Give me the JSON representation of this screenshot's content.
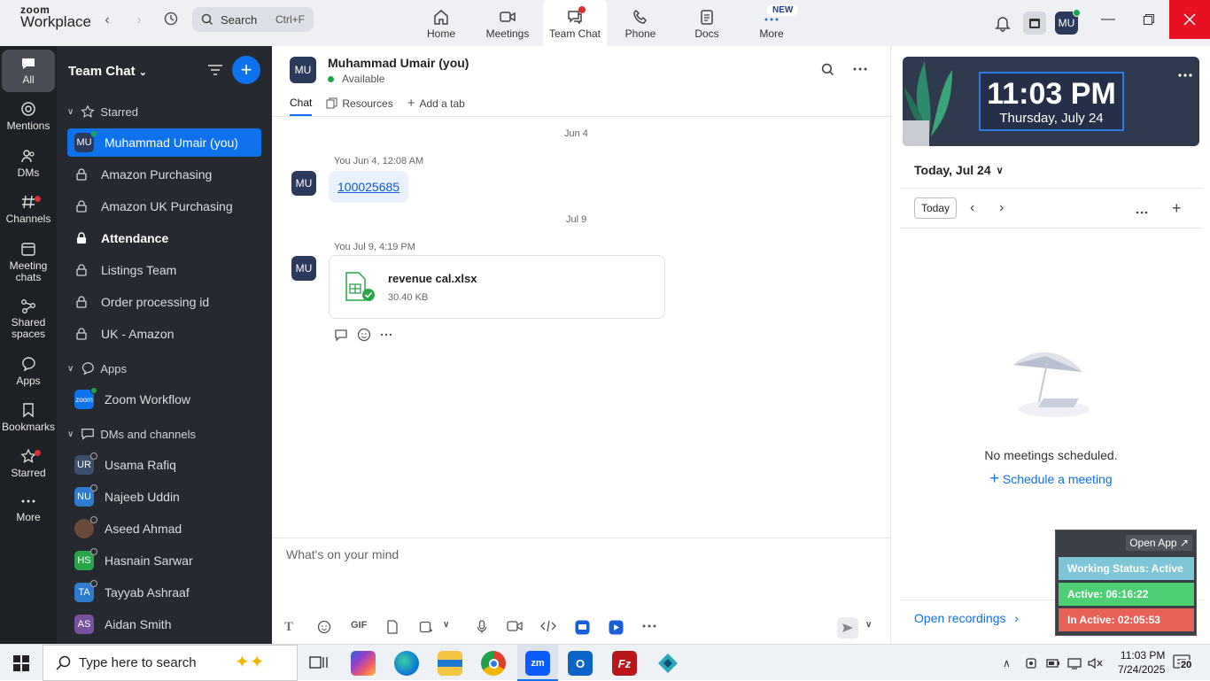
{
  "app": {
    "brand_top": "zoom",
    "brand_bottom": "Workplace"
  },
  "search": {
    "label": "Search",
    "shortcut": "Ctrl+F"
  },
  "nav": [
    {
      "label": "Home",
      "icon": "home-icon"
    },
    {
      "label": "Meetings",
      "icon": "video-icon"
    },
    {
      "label": "Team Chat",
      "icon": "chat-icon",
      "active": true
    },
    {
      "label": "Phone",
      "icon": "phone-icon"
    },
    {
      "label": "Docs",
      "icon": "docs-icon"
    },
    {
      "label": "More",
      "icon": "more-icon",
      "badge": "NEW"
    }
  ],
  "user_avatar": "MU",
  "rail": [
    {
      "label": "All"
    },
    {
      "label": "Mentions"
    },
    {
      "label": "DMs"
    },
    {
      "label": "Channels"
    },
    {
      "label": "Meeting chats"
    },
    {
      "label": "Shared spaces"
    },
    {
      "label": "Apps"
    },
    {
      "label": "Bookmarks"
    },
    {
      "label": "Starred"
    },
    {
      "label": "More"
    }
  ],
  "sidebar": {
    "title": "Team Chat",
    "sections": {
      "starred": "Starred",
      "apps": "Apps",
      "dms": "DMs and channels"
    },
    "starred_items": [
      {
        "label": "Muhammad Umair (you)",
        "avatar": "MU"
      },
      {
        "label": "Amazon Purchasing"
      },
      {
        "label": "Amazon UK Purchasing"
      },
      {
        "label": "Attendance"
      },
      {
        "label": "Listings Team"
      },
      {
        "label": "Order processing id"
      },
      {
        "label": "UK - Amazon"
      }
    ],
    "apps_items": [
      {
        "label": "Zoom Workflow",
        "avatar": "zoom"
      }
    ],
    "dm_items": [
      {
        "label": "Usama Rafiq",
        "avatar": "UR",
        "color": "#3d4f6e"
      },
      {
        "label": "Najeeb Uddin",
        "avatar": "NU",
        "color": "#2e7bcf"
      },
      {
        "label": "Aseed Ahmad",
        "avatar": "",
        "color": "#6b4a3a"
      },
      {
        "label": "Hasnain Sarwar",
        "avatar": "HS",
        "color": "#2aa64a"
      },
      {
        "label": "Tayyab Ashraaf",
        "avatar": "TA",
        "color": "#2e7bcf"
      },
      {
        "label": "Aidan Smith",
        "avatar": "AS",
        "color": "#7a4fa0"
      }
    ]
  },
  "chat": {
    "avatar": "MU",
    "name": "Muhammad Umair (you)",
    "status": "Available",
    "tabs": [
      "Chat",
      "Resources",
      "Add a tab"
    ],
    "date1": "Jun 4",
    "msg1_meta": "You Jun 4, 12:08 AM",
    "msg1_link": "100025685",
    "date2": "Jul 9",
    "msg2_meta": "You Jul 9, 4:19 PM",
    "file_name": "revenue cal.xlsx",
    "file_size": "30.40 KB",
    "composer_placeholder": "What's on your mind",
    "toolbar_gif": "GIF"
  },
  "calendar": {
    "clock_time": "11:03 PM",
    "clock_date": "Thursday, July 24",
    "title": "Today, Jul 24",
    "today_btn": "Today",
    "empty": "No meetings scheduled.",
    "schedule": "Schedule a meeting",
    "open_recordings": "Open recordings"
  },
  "widget": {
    "open_app": "Open App ↗",
    "working_status": "Working Status: Active",
    "active": "Active: 06:16:22",
    "inactive": "In Active: 02:05:53"
  },
  "taskbar": {
    "search_placeholder": "Type here to search",
    "time": "11:03 PM",
    "date": "7/24/2025",
    "notif_count": "20"
  },
  "colors": {
    "accent": "#0e72ed",
    "sidebar": "#26292f",
    "rail": "#1d2025",
    "working": "#7ec6d6",
    "active": "#4fcf74",
    "inactive": "#e8625a"
  }
}
